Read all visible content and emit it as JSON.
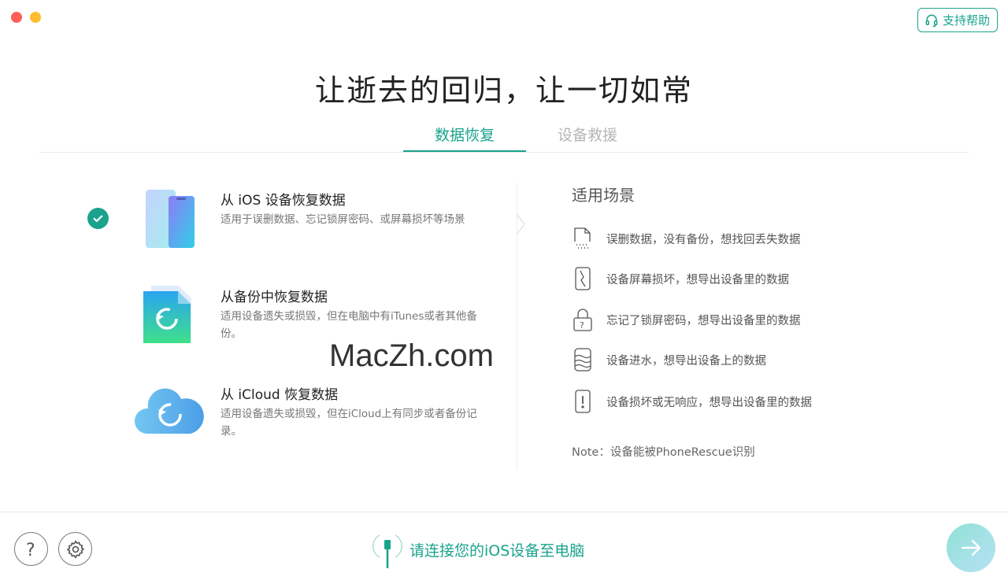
{
  "window": {
    "traffic_lights": [
      "close",
      "minimize"
    ]
  },
  "header": {
    "support_label": "支持帮助",
    "support_icon": "headset-icon"
  },
  "title": "让逝去的回归，让一切如常",
  "tabs": [
    {
      "label": "数据恢复",
      "active": true
    },
    {
      "label": "设备救援",
      "active": false
    }
  ],
  "options": [
    {
      "title": "从 iOS 设备恢复数据",
      "desc": "适用于误删数据、忘记锁屏密码、或屏幕损坏等场景",
      "selected": true,
      "icon": "iphone-icon"
    },
    {
      "title": "从备份中恢复数据",
      "desc": "适用设备遗失或损毁，但在电脑中有iTunes或者其他备份。",
      "selected": false,
      "icon": "backup-file-icon"
    },
    {
      "title": "从 iCloud 恢复数据",
      "desc": "适用设备遗失或损毁，但在iCloud上有同步或者备份记录。",
      "selected": false,
      "icon": "icloud-icon"
    }
  ],
  "scenarios": {
    "title": "适用场景",
    "items": [
      {
        "text": "误删数据，没有备份，想找回丢失数据",
        "icon": "deleted-file-icon"
      },
      {
        "text": "设备屏幕损坏，想导出设备里的数据",
        "icon": "broken-screen-icon"
      },
      {
        "text": "忘记了锁屏密码，想导出设备里的数据",
        "icon": "lock-question-icon"
      },
      {
        "text": "设备进水，想导出设备上的数据",
        "icon": "water-damage-icon"
      },
      {
        "text": "设备损坏或无响应，想导出设备里的数据",
        "icon": "device-warning-icon"
      }
    ],
    "note": "Note：设备能被PhoneRescue识别"
  },
  "watermark": "MacZh.com",
  "footer": {
    "help_icon": "help-icon",
    "settings_icon": "gear-icon",
    "connect_text": "请连接您的iOS设备至电脑",
    "next_icon": "arrow-right-icon"
  },
  "colors": {
    "accent": "#19a38c",
    "close": "#fe5f57",
    "minimize": "#febc2e"
  }
}
